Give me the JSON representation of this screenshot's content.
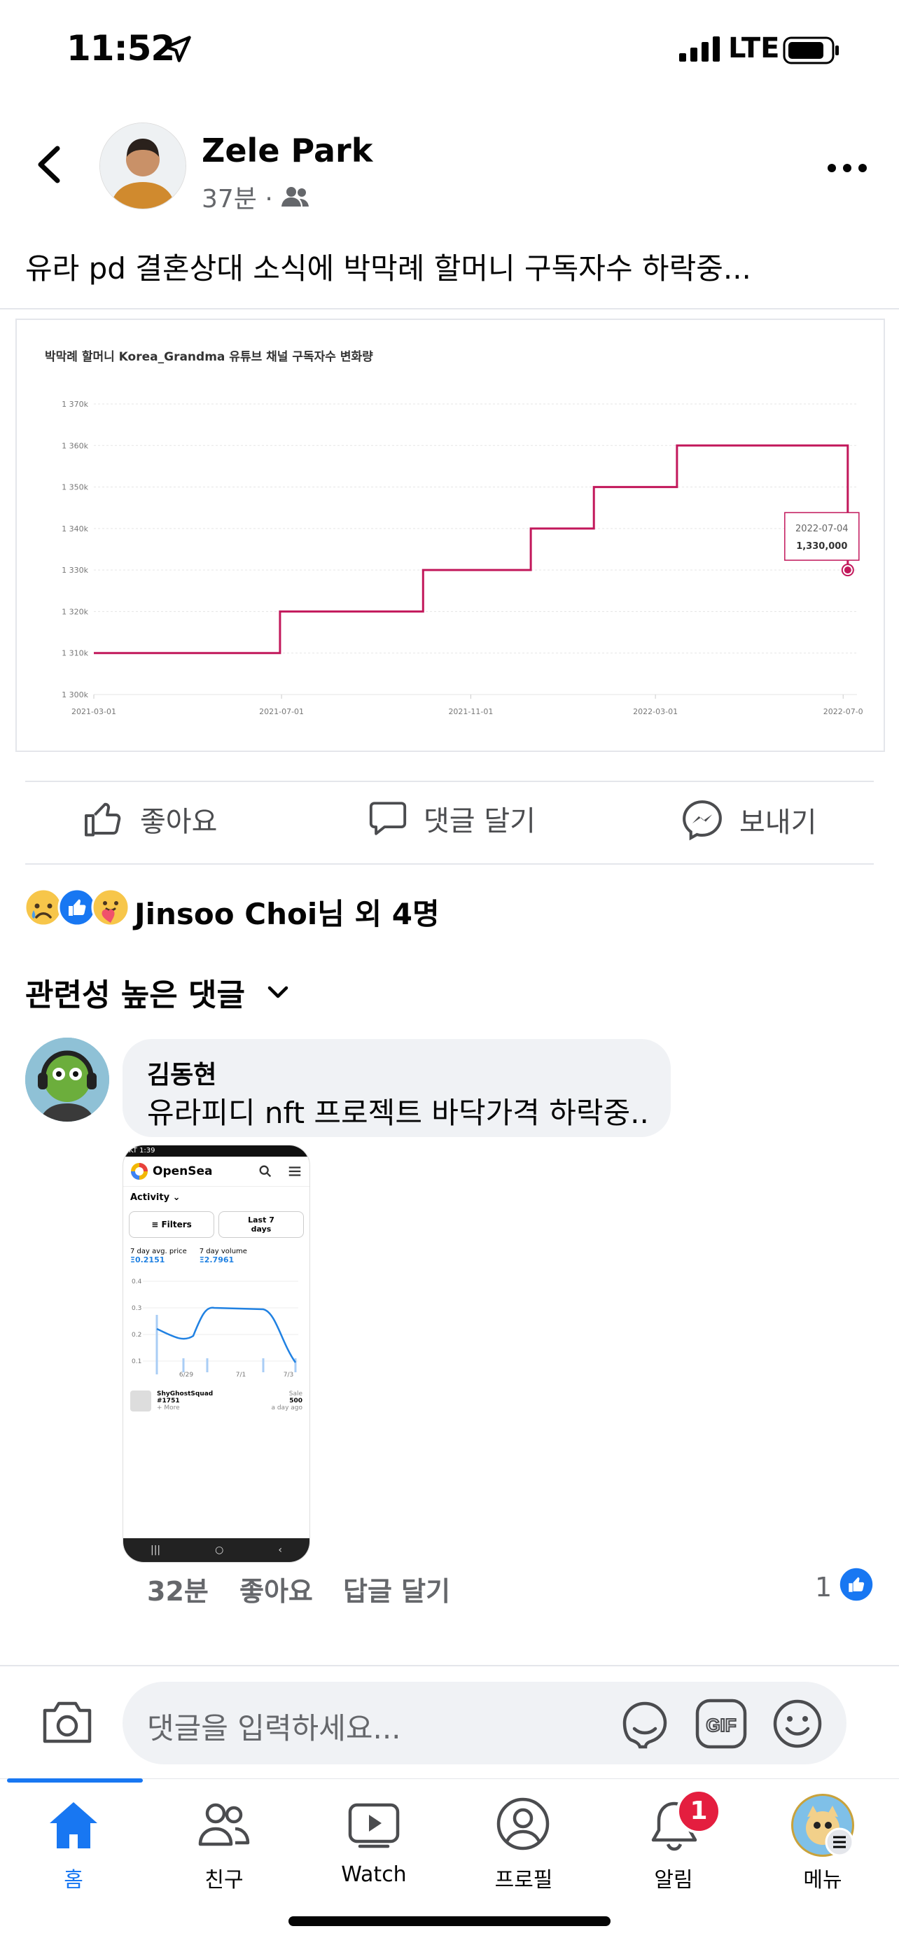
{
  "status_bar": {
    "time": "11:52",
    "network": "LTE"
  },
  "post": {
    "author": "Zele Park",
    "time_ago": "37분 ·",
    "text": "유라 pd 결혼상대 소식에 박막례 할머니 구독자수 하락중..."
  },
  "chart_data": {
    "type": "line",
    "title": "박막례 할머니 Korea_Grandma 유튜브 채널 구독자수 변화량",
    "x_ticks": [
      "2021-03-01",
      "2021-07-01",
      "2021-11-01",
      "2022-03-01",
      "2022-07-0"
    ],
    "y_ticks": [
      "1 300k",
      "1 310k",
      "1 320k",
      "1 330k",
      "1 340k",
      "1 350k",
      "1 360k",
      "1 370k"
    ],
    "ylim": [
      1300000,
      1370000
    ],
    "xlim": [
      "2021-03-01",
      "2022-07-10"
    ],
    "series": [
      {
        "points": [
          {
            "x": "2021-03-01",
            "y": 1310000
          },
          {
            "x": "2021-06-30",
            "y": 1310000
          },
          {
            "x": "2021-06-30",
            "y": 1320000
          },
          {
            "x": "2021-10-01",
            "y": 1320000
          },
          {
            "x": "2021-10-01",
            "y": 1330000
          },
          {
            "x": "2021-12-10",
            "y": 1330000
          },
          {
            "x": "2021-12-10",
            "y": 1340000
          },
          {
            "x": "2022-01-20",
            "y": 1340000
          },
          {
            "x": "2022-01-20",
            "y": 1350000
          },
          {
            "x": "2022-03-15",
            "y": 1350000
          },
          {
            "x": "2022-03-15",
            "y": 1360000
          },
          {
            "x": "2022-07-04",
            "y": 1360000
          },
          {
            "x": "2022-07-04",
            "y": 1330000
          }
        ]
      }
    ],
    "tooltip": {
      "date": "2022-07-04",
      "value": "1,330,000"
    },
    "line_color": "#c2185b",
    "grid": true
  },
  "actions": {
    "like": "좋아요",
    "comment": "댓글 달기",
    "send": "보내기"
  },
  "reactions": {
    "text": "Jinsoo Choi님 외 4명"
  },
  "comments_filter": "관련성 높은 댓글",
  "comment": {
    "author": "김동현",
    "text": "유라피디 nft 프로젝트 바닥가격 하락중..",
    "time_ago": "32분",
    "like_action": "좋아요",
    "reply_action": "답글 달기",
    "like_count": "1",
    "screenshot": {
      "status": "KT 1:39",
      "brand": "OpenSea",
      "activity": "Activity",
      "filters": "Filters",
      "period": "Last 7 days",
      "avg_label": "7 day avg. price",
      "avg_value": "Ξ0.2151",
      "vol_label": "7 day volume",
      "vol_value": "Ξ2.7961",
      "y_ticks": [
        "0.4",
        "0.3",
        "0.2",
        "0.1"
      ],
      "x_ticks": [
        "6/29",
        "7/1",
        "7/3"
      ],
      "item_name": "ShyGhostSquad",
      "item_id": "#1751",
      "item_more": "+ More",
      "sale_label": "Sale",
      "sale_value": "500",
      "sale_time": "a day ago"
    }
  },
  "comment_input": {
    "placeholder": "댓글을 입력하세요..."
  },
  "tabs": [
    {
      "label": "홈",
      "active": true
    },
    {
      "label": "친구"
    },
    {
      "label": "Watch"
    },
    {
      "label": "프로필"
    },
    {
      "label": "알림",
      "badge": "1"
    },
    {
      "label": "메뉴"
    }
  ],
  "colors": {
    "accent": "#1877f2",
    "badge": "#e41e3f",
    "chart_line": "#c2185b"
  }
}
